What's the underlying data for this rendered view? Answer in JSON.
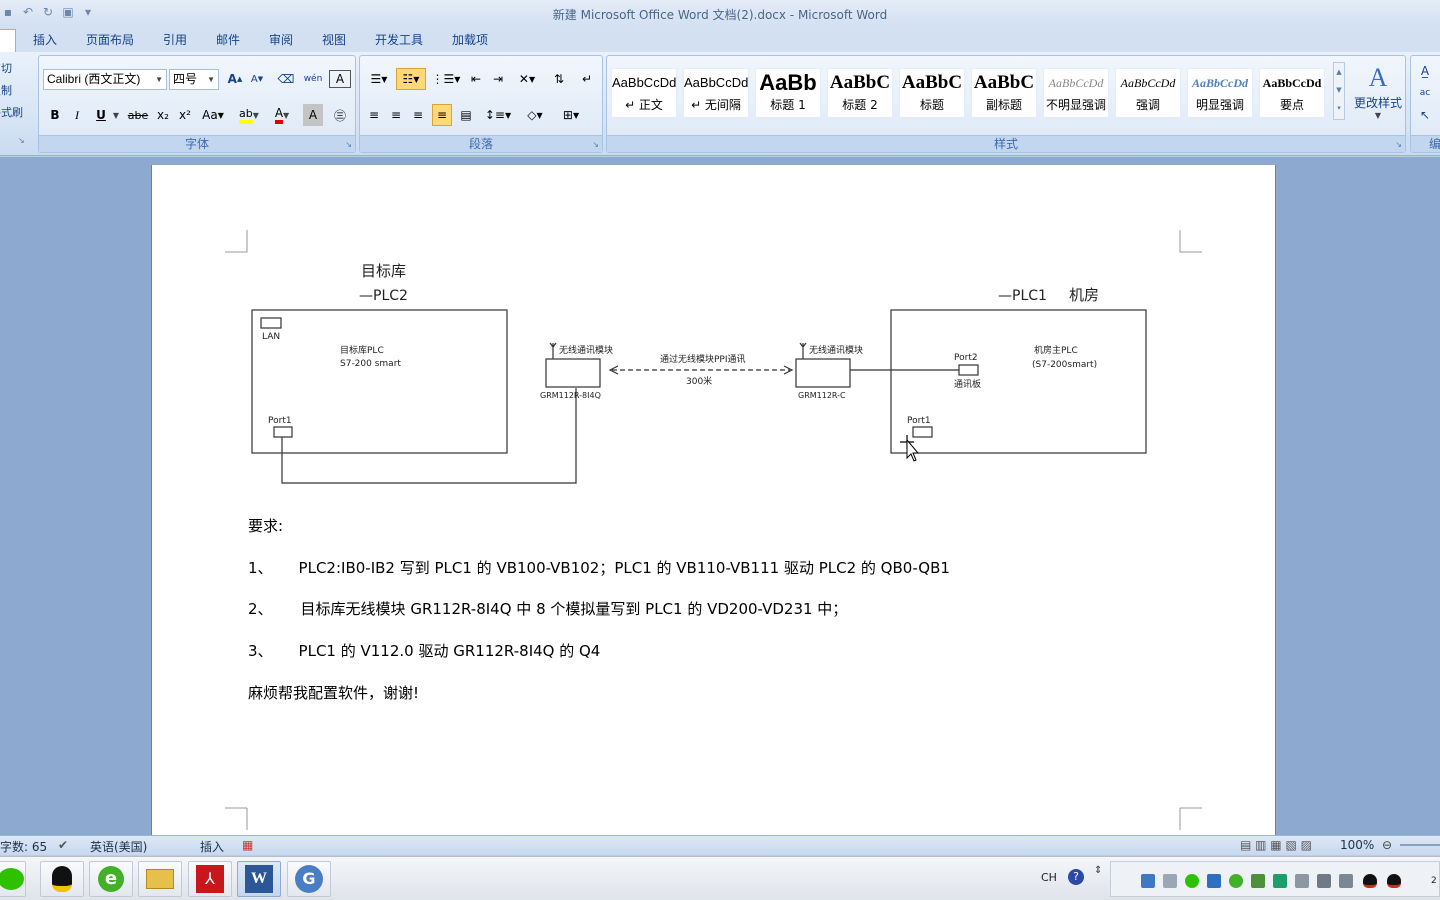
{
  "window": {
    "title": "新建 Microsoft Office Word 文档(2).docx - Microsoft Word"
  },
  "tabs": [
    "插入",
    "页面布局",
    "引用",
    "邮件",
    "审阅",
    "视图",
    "开发工具",
    "加载项"
  ],
  "clipboard": {
    "cut": "剪切",
    "copy": "复制",
    "format_painter": "格式刷"
  },
  "font": {
    "name": "Calibri (西文正文)",
    "size": "四号",
    "group_label": "字体",
    "buttons": {
      "bold": "B",
      "italic": "I",
      "underline": "U",
      "strike": "abe",
      "subscript": "x₂",
      "superscript": "x²",
      "case": "Aa",
      "grow": "A",
      "shrink": "A"
    }
  },
  "paragraph": {
    "group_label": "段落"
  },
  "styles": {
    "group_label": "样式",
    "change_styles": "更改样式",
    "items": [
      {
        "sample": "AaBbCcDd",
        "name": "↵ 正文"
      },
      {
        "sample": "AaBbCcDd",
        "name": "↵ 无间隔"
      },
      {
        "sample": "AaBb",
        "name": "标题 1"
      },
      {
        "sample": "AaBbC",
        "name": "标题 2"
      },
      {
        "sample": "AaBbC",
        "name": "标题"
      },
      {
        "sample": "AaBbC",
        "name": "副标题"
      },
      {
        "sample": "AaBbCcDd",
        "name": "不明显强调"
      },
      {
        "sample": "AaBbCcDd",
        "name": "强调"
      },
      {
        "sample": "AaBbCcDd",
        "name": "明显强调"
      },
      {
        "sample": "AaBbCcDd",
        "name": "要点"
      }
    ]
  },
  "editing": {
    "group_label": "编"
  },
  "diagram": {
    "left_title": "目标库",
    "left_subtitle": "—PLC2",
    "right_subtitle": "—PLC1",
    "right_title": "机房",
    "left_box": {
      "lan": "LAN",
      "plc_line1": "目标库PLC",
      "plc_line2": "S7-200 smart",
      "port": "Port1"
    },
    "left_module": {
      "label": "无线通讯模块",
      "model": "GRM112R-8I4Q"
    },
    "link": {
      "label": "通过无线模块PPI通讯",
      "distance": "300米"
    },
    "right_module": {
      "label": "无线通讯模块",
      "model": "GRM112R-C"
    },
    "right_box": {
      "port2": "Port2",
      "comm_board": "通讯板",
      "plc_line1": "机房主PLC",
      "plc_line2": "(S7-200smart)",
      "port": "Port1"
    }
  },
  "document": {
    "heading": "要求:",
    "items": [
      {
        "num": "1、",
        "text": "PLC2:IB0-IB2 写到 PLC1 的 VB100-VB102；PLC1 的 VB110-VB111 驱动 PLC2 的 QB0-QB1"
      },
      {
        "num": "2、",
        "text": "目标库无线模块 GR112R-8I4Q 中 8 个模拟量写到 PLC1 的 VD200-VD231 中；"
      },
      {
        "num": "3、",
        "text": "PLC1 的 V112.0 驱动 GR112R-8I4Q 的 Q4"
      }
    ],
    "closing": "麻烦帮我配置软件，谢谢!"
  },
  "status": {
    "word_count": "字数: 65",
    "language": "英语(美国)",
    "mode": "插入",
    "zoom": "100%"
  },
  "taskbar": {
    "lang": "CH"
  }
}
